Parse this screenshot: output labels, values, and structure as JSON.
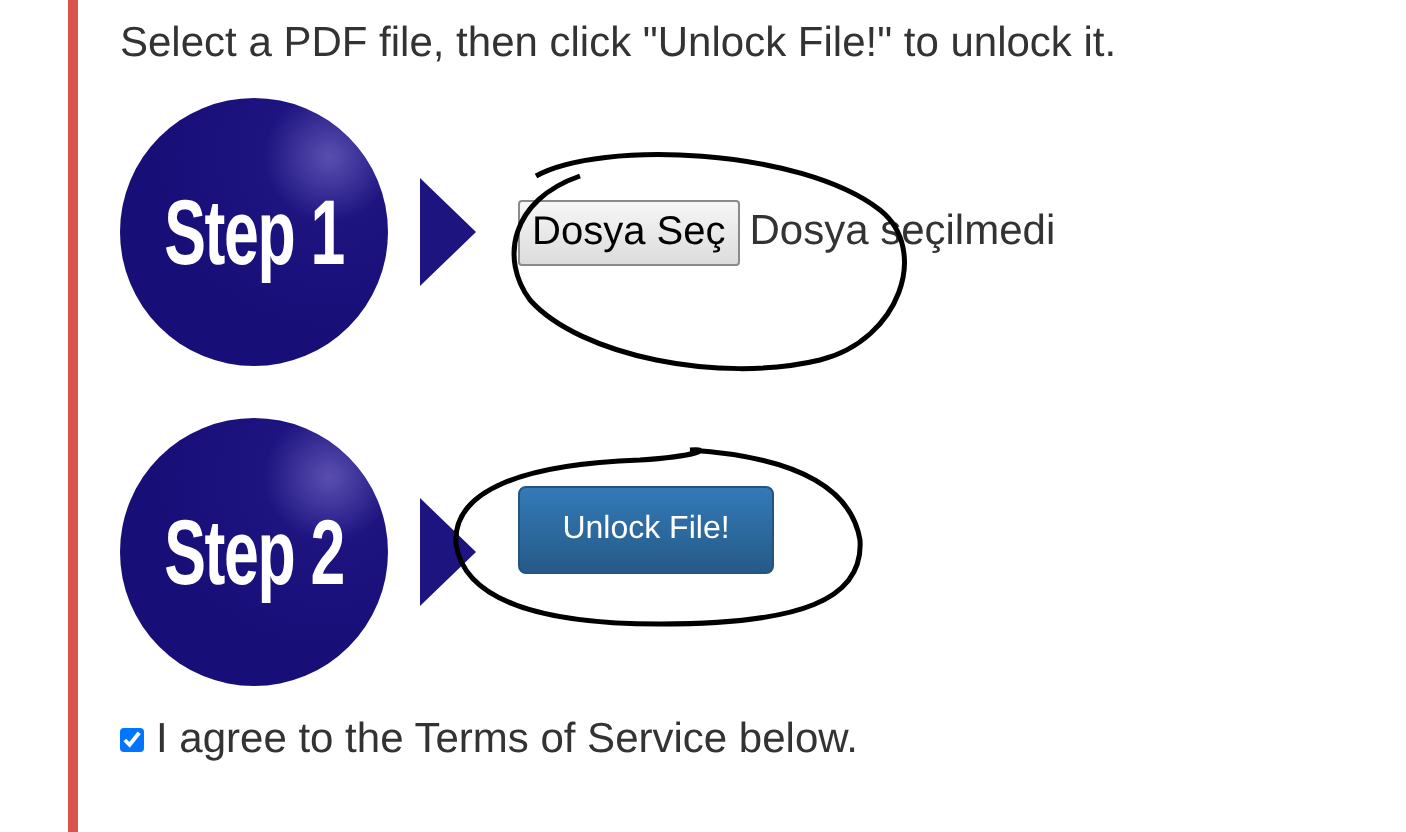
{
  "instructions": "Select a PDF file, then click \"Unlock File!\" to unlock it.",
  "steps": [
    {
      "label": "Step 1",
      "kind": "file",
      "button_label": "Dosya Seç",
      "status": "Dosya seçilmedi"
    },
    {
      "label": "Step 2",
      "kind": "submit",
      "button_label": "Unlock File!"
    }
  ],
  "agree": {
    "label": "I agree to the Terms of Service below.",
    "checked": true
  }
}
